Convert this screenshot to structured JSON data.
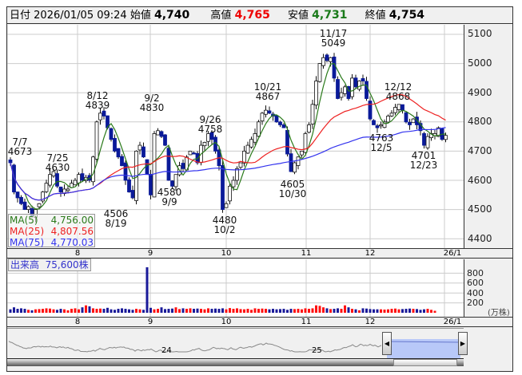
{
  "header": {
    "date_label": "日付",
    "datetime": "2026/01/05 09:24",
    "open_label": "始値",
    "open": "4,740",
    "high_label": "高値",
    "high": "4,765",
    "low_label": "安値",
    "low": "4,731",
    "close_label": "終値",
    "close": "4,754"
  },
  "colors": {
    "up": "#ffffff",
    "down": "#0a1a99",
    "ma5": "#2a7a1a",
    "ma25": "#ee2222",
    "ma75": "#3333ee",
    "vol_up": "#ff1111",
    "vol_down": "#1a1a99"
  },
  "price_axis": [
    "5100",
    "5000",
    "4900",
    "4800",
    "4700",
    "4600",
    "4500",
    "4400"
  ],
  "date_axis": [
    "8",
    "9",
    "10",
    "11",
    "12",
    "26/1"
  ],
  "volume_axis": [
    "800",
    "600",
    "400",
    "200"
  ],
  "volume_unit": "(万株)",
  "volume_label": "出来高",
  "volume_value": "75,600株",
  "ma": [
    {
      "name": "MA(5)",
      "value": "4,756.00"
    },
    {
      "name": "MA(25)",
      "value": "4,807.56"
    },
    {
      "name": "MA(75)",
      "value": "4,770.03"
    }
  ],
  "annotations": [
    {
      "date": "7/7",
      "value": "4673"
    },
    {
      "date": "7/25",
      "value": "4630"
    },
    {
      "date": "8/12",
      "value": "4839"
    },
    {
      "date": "9/2",
      "value": "4830"
    },
    {
      "date": "9/26",
      "value": "4758"
    },
    {
      "date": "10/21",
      "value": "4867"
    },
    {
      "date": "11/17",
      "value": "5049"
    },
    {
      "date": "12/12",
      "value": "4868"
    },
    {
      "date": "8/19",
      "value": "4506"
    },
    {
      "date": "9/9",
      "value": "4580"
    },
    {
      "date": "10/2",
      "value": "4480"
    },
    {
      "date": "10/30",
      "value": "4605"
    },
    {
      "date": "12/5",
      "value": "4763"
    },
    {
      "date": "12/23",
      "value": "4701"
    }
  ],
  "navigator_labels": [
    "24",
    "25"
  ],
  "chart_data": {
    "type": "candlestick",
    "ylim": [
      4380,
      5130
    ],
    "closes": [
      4660,
      4560,
      4540,
      4520,
      4500,
      4510,
      4480,
      4500,
      4520,
      4560,
      4590,
      4620,
      4630,
      4580,
      4560,
      4570,
      4570,
      4590,
      4600,
      4620,
      4600,
      4610,
      4600,
      4680,
      4800,
      4830,
      4820,
      4780,
      4740,
      4700,
      4680,
      4650,
      4600,
      4560,
      4540,
      4700,
      4720,
      4680,
      4620,
      4550,
      4760,
      4770,
      4750,
      4720,
      4600,
      4580,
      4620,
      4650,
      4640,
      4680,
      4700,
      4690,
      4660,
      4720,
      4730,
      4760,
      4740,
      4700,
      4650,
      4500,
      4520,
      4580,
      4600,
      4640,
      4660,
      4700,
      4720,
      4740,
      4760,
      4800,
      4830,
      4840,
      4830,
      4820,
      4800,
      4790,
      4780,
      4690,
      4630,
      4660,
      4680,
      4700,
      4760,
      4790,
      4860,
      4940,
      5000,
      5020,
      5010,
      5020,
      4950,
      4880,
      4900,
      4920,
      4880,
      4950,
      4920,
      4940,
      4940,
      4880,
      4810,
      4790,
      4780,
      4790,
      4800,
      4820,
      4830,
      4850,
      4860,
      4840,
      4800,
      4790,
      4810,
      4790,
      4770,
      4720,
      4750,
      4760,
      4760,
      4780,
      4740,
      4754
    ],
    "volumes": [
      70,
      110,
      80,
      90,
      80,
      60,
      50,
      70,
      75,
      80,
      90,
      85,
      70,
      60,
      80,
      70,
      50,
      80,
      90,
      70,
      110,
      150,
      130,
      90,
      80,
      85,
      80,
      100,
      70,
      60,
      80,
      90,
      80,
      70,
      60,
      80,
      70,
      60,
      920,
      100,
      70,
      80,
      110,
      75,
      80,
      85,
      110,
      75,
      90,
      80,
      90,
      80,
      85,
      80,
      70,
      90,
      80,
      85,
      80,
      90,
      70,
      95,
      80,
      90,
      75,
      70,
      80,
      60,
      90,
      80,
      85,
      80,
      70,
      80,
      70,
      75,
      80,
      60,
      80,
      75,
      80,
      70,
      90,
      80,
      90,
      150,
      140,
      110,
      90,
      75,
      80,
      90,
      80,
      150,
      110,
      80,
      70,
      50,
      90,
      85,
      75,
      70,
      70,
      70,
      65,
      70,
      80,
      85,
      70,
      75,
      80,
      85,
      80,
      75,
      60,
      70,
      80,
      60,
      40
    ]
  }
}
